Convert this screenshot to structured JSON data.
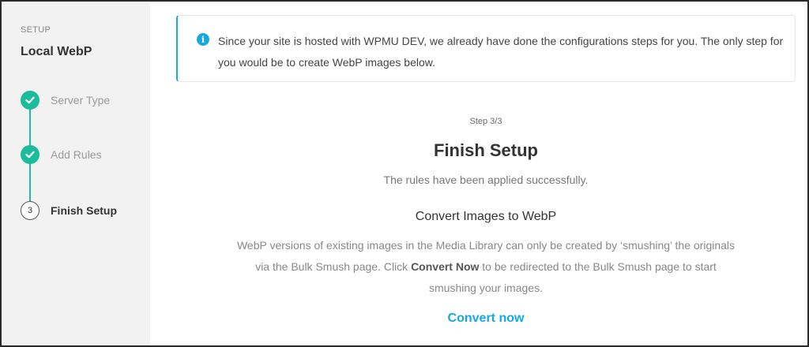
{
  "sidebar": {
    "label": "SETUP",
    "title": "Local WebP",
    "steps": [
      {
        "label": "Server Type",
        "status": "done",
        "icon": "checkmark-icon"
      },
      {
        "label": "Add Rules",
        "status": "done",
        "icon": "checkmark-icon"
      },
      {
        "label": "Finish Setup",
        "status": "current",
        "number": "3"
      }
    ]
  },
  "notice": {
    "icon": "info-icon",
    "text": "Since your site is hosted with WPMU DEV, we already have done the configurations steps for you. The only step for you would be to create WebP images below."
  },
  "main": {
    "step_count": "Step 3/3",
    "title": "Finish Setup",
    "success": "The rules have been applied successfully.",
    "convert_title": "Convert Images to WebP",
    "convert_desc_1": "WebP versions of existing images in the Media Library can only be created by ‘smushing’ the originals via the Bulk Smush page. Click ",
    "convert_desc_bold": "Convert Now",
    "convert_desc_2": " to be redirected to the Bulk Smush page to start smushing your images.",
    "convert_link": "Convert now"
  },
  "colors": {
    "accent": "#17a8e3",
    "success": "#1abc9c",
    "sidebar_bg": "#f2f2f2"
  }
}
